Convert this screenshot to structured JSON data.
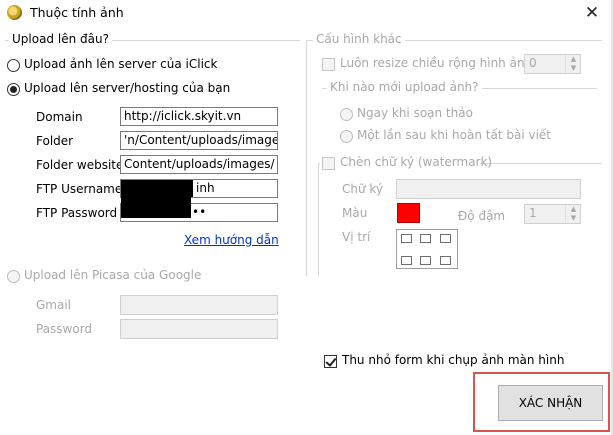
{
  "window": {
    "title": "Thuộc tính ảnh",
    "close_glyph": "✕",
    "icon": "app-icon"
  },
  "upload_group": {
    "title": "Upload lên đâu?",
    "option_iclick": "Upload ảnh lên server của iClick",
    "option_hosting": "Upload lên server/hosting của bạn",
    "selected": "hosting",
    "domain_label": "Domain",
    "domain_value": "http://iclick.skyit.vn",
    "folder_label": "Folder",
    "folder_value": "'n/Content/uploads/images/",
    "folder_website_label": "Folder website",
    "folder_website_value": "Content/uploads/images/",
    "ftp_username_label": "FTP Username",
    "ftp_username_value": "inh",
    "ftp_password_label": "FTP Password",
    "ftp_password_value": "••",
    "guide_link": "Xem hướng dẫn",
    "option_picasa": "Upload lên Picasa của Google",
    "gmail_label": "Gmail",
    "gmail_value": "",
    "password_label": "Password",
    "password_value": ""
  },
  "config_group": {
    "title": "Cấu hình khác",
    "resize_label": "Luôn resize chiều rộng hình ảnh",
    "resize_checked": false,
    "resize_value": "0",
    "when_title": "Khi nào mới upload ảnh?",
    "when_compose": "Ngay khi soạn thảo",
    "when_finish": "Một lần sau khi hoàn tất bài viết",
    "watermark_label": "Chèn chữ ký (watermark)",
    "watermark_checked": false,
    "signature_label": "Chữ ký",
    "signature_value": "",
    "color_label": "Màu",
    "color_value": "#ff0000",
    "opacity_label": "Độ đậm",
    "opacity_value": "1",
    "position_label": "Vị trí"
  },
  "minimize_label": "Thu nhỏ form khi chụp ảnh màn hình",
  "minimize_checked": true,
  "confirm_label": "XÁC NHẬN",
  "colors": {
    "highlight": "#d9534f",
    "link": "#0033cc",
    "swatch": "#ff0000"
  }
}
